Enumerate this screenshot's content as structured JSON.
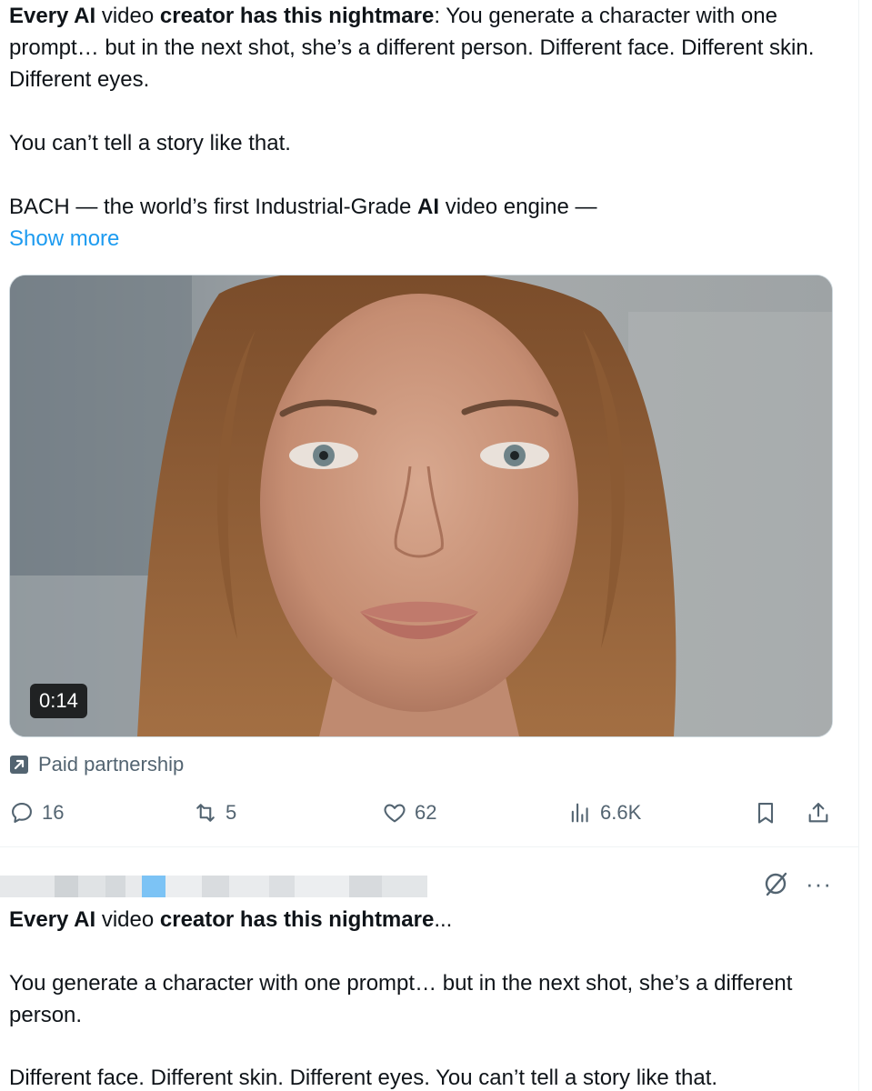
{
  "tweet1": {
    "p1": {
      "s1": "Every AI",
      "s2": " video ",
      "s3": "creator has this nightmare",
      "s4": ": You generate a character with one prompt… but in the next shot, she’s a different person. Different face. Different skin. Different eyes."
    },
    "p2": "You can’t tell a story like that.",
    "p3": {
      "s1": "BACH — the world’s first Industrial-Grade ",
      "s2": "AI",
      "s3": " video engine —"
    },
    "show_more": "Show more",
    "video": {
      "duration": "0:14"
    },
    "paid_partnership": "Paid partnership",
    "actions": {
      "reply_count": "16",
      "retweet_count": "5",
      "like_count": "62",
      "views_count": "6.6K"
    }
  },
  "tweet2": {
    "p1": {
      "s1": "Every AI",
      "s2": " video ",
      "s3": "creator has this nightmare",
      "s4": "..."
    },
    "p2": "You generate a character with one prompt… but in the next shot, she’s a different person.",
    "p3": "Different face. Different skin. Different eyes. You can’t tell a story like that.",
    "more_label": "···"
  },
  "icons": {
    "reply": "reply-icon",
    "retweet": "retweet-icon",
    "like": "heart-icon",
    "views": "views-bar-chart-icon",
    "bookmark": "bookmark-icon",
    "share": "share-icon",
    "paid": "arrow-up-right-box-icon",
    "grok": "slashed-circle-icon",
    "more": "more-dots-icon"
  },
  "colors": {
    "text": "#0f1419",
    "muted": "#536471",
    "link": "#1d9bf0"
  }
}
